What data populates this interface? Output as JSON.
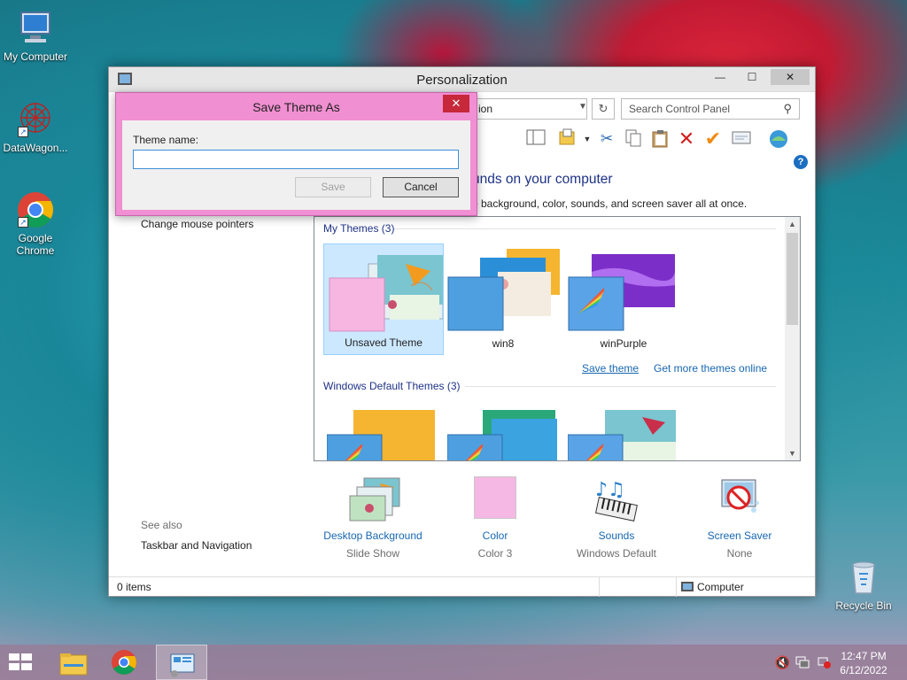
{
  "desktop": {
    "icons": [
      {
        "label": "My Computer"
      },
      {
        "label": "DataWagon..."
      },
      {
        "label": "Google Chrome"
      },
      {
        "label": "Recycle Bin"
      }
    ]
  },
  "window": {
    "title": "Personalization",
    "address_text": "ion",
    "search_placeholder": "Search Control Panel",
    "heading": "unds on your computer",
    "subheading": "p background, color, sounds, and screen saver all at once.",
    "left_links": [
      "Change mouse pointers"
    ],
    "see_also_label": "See also",
    "see_also_links": [
      "Taskbar and Navigation"
    ],
    "help_glyph": "?",
    "themes": {
      "my_group": "My Themes (3)",
      "my_themes": [
        {
          "label": "Unsaved Theme",
          "selected": true
        },
        {
          "label": "win8",
          "selected": false
        },
        {
          "label": "winPurple",
          "selected": false
        }
      ],
      "save_theme_link": "Save theme",
      "get_more_link": "Get more themes online",
      "default_group": "Windows Default Themes (3)"
    },
    "settings": [
      {
        "name": "Desktop Background",
        "sub": "Slide Show",
        "icon": "desktop-background-icon"
      },
      {
        "name": "Color",
        "sub": "Color 3",
        "icon": "color-swatch-icon",
        "color": "#f5b7e3"
      },
      {
        "name": "Sounds",
        "sub": "Windows Default",
        "icon": "sounds-icon"
      },
      {
        "name": "Screen Saver",
        "sub": "None",
        "icon": "screen-saver-icon"
      }
    ],
    "status": {
      "items": "0 items",
      "location": "Computer"
    }
  },
  "dialog": {
    "title": "Save Theme As",
    "label": "Theme name:",
    "input_value": "",
    "save_label": "Save",
    "cancel_label": "Cancel",
    "accent": "#f08fd1"
  },
  "taskbar": {
    "time": "12:47 PM",
    "date": "6/12/2022"
  }
}
